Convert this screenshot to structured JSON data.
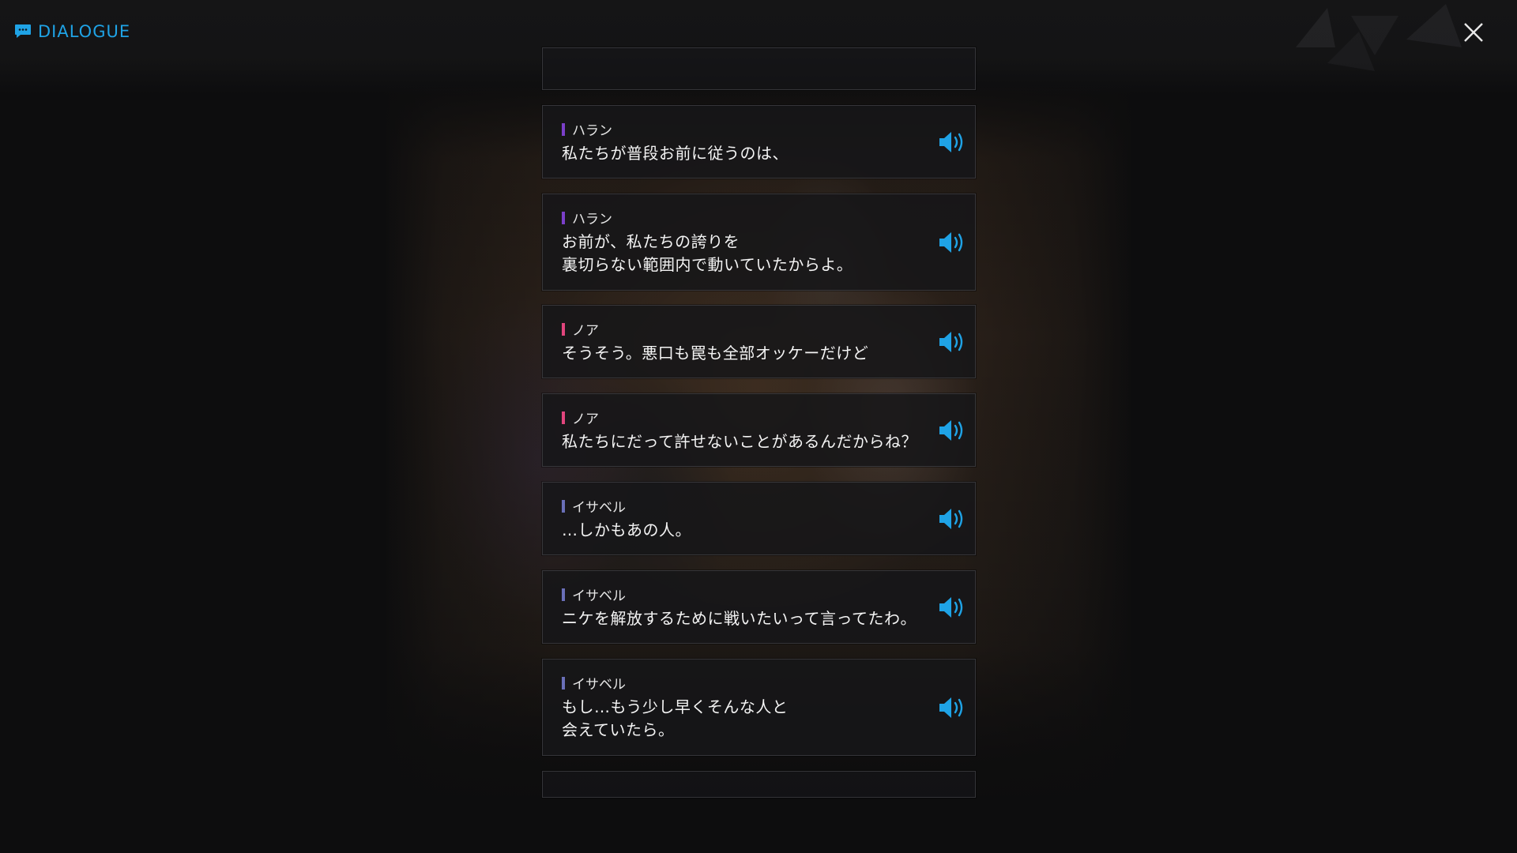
{
  "header": {
    "title": "DIALOGUE",
    "title_icon": "chat-bubble-icon",
    "close_icon": "close-icon",
    "accent_color": "#1fa3e6"
  },
  "speaker_colors": {
    "ハラン": "#7b3fc9",
    "ノア": "#e2457d",
    "イサベル": "#6a6fb8"
  },
  "voice_icon": "speaker-volume-icon",
  "entries": [
    {
      "speaker": "ハラン",
      "text": "私たちが普段お前に従うのは、"
    },
    {
      "speaker": "ハラン",
      "text": "お前が、私たちの誇りを\n裏切らない範囲内で動いていたからよ。"
    },
    {
      "speaker": "ノア",
      "text": "そうそう。悪口も罠も全部オッケーだけど"
    },
    {
      "speaker": "ノア",
      "text": "私たちにだって許せないことがあるんだからね？"
    },
    {
      "speaker": "イサベル",
      "text": "…しかもあの人。"
    },
    {
      "speaker": "イサベル",
      "text": "ニケを解放するために戦いたいって言ってたわ。"
    },
    {
      "speaker": "イサベル",
      "text": "もし…もう少し早くそんな人と\n会えていたら。"
    }
  ]
}
